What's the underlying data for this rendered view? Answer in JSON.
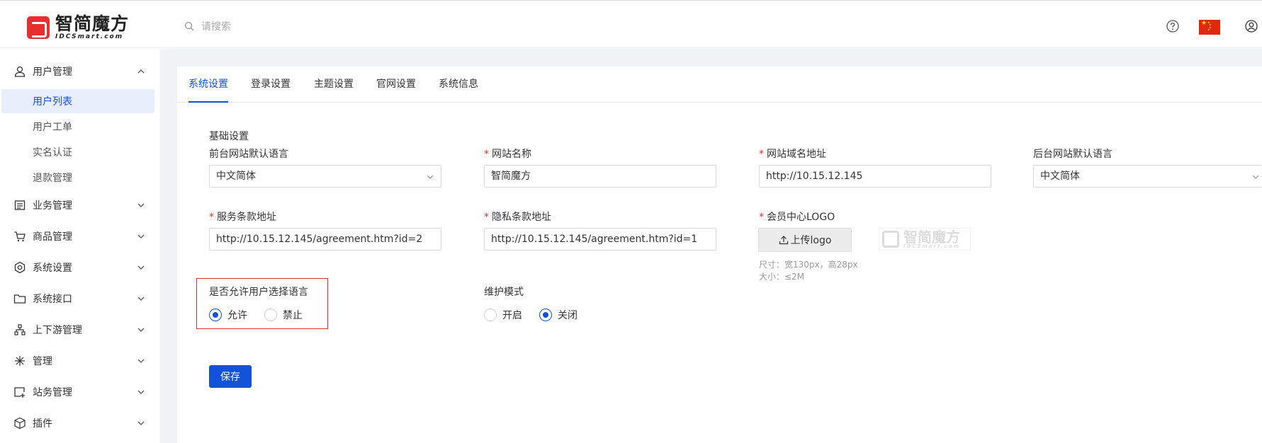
{
  "header": {
    "logo_cn": "智简魔方",
    "logo_en": "IDCSmart.com",
    "search_placeholder": "请搜索",
    "icons": [
      "help-icon",
      "flag-cn-icon",
      "user-icon"
    ]
  },
  "sidebar": {
    "groups": [
      {
        "label": "用户管理",
        "icon": "user-icon",
        "expanded": true,
        "items": [
          {
            "label": "用户列表",
            "active": true
          },
          {
            "label": "用户工单"
          },
          {
            "label": "实名认证"
          },
          {
            "label": "退款管理"
          }
        ]
      },
      {
        "label": "业务管理",
        "icon": "list-icon"
      },
      {
        "label": "商品管理",
        "icon": "cart-icon"
      },
      {
        "label": "系统设置",
        "icon": "gear-icon"
      },
      {
        "label": "系统接口",
        "icon": "folder-icon"
      },
      {
        "label": "上下游管理",
        "icon": "hierarchy-icon"
      },
      {
        "label": "管理",
        "icon": "sparkle-icon"
      },
      {
        "label": "站务管理",
        "icon": "site-icon"
      },
      {
        "label": "插件",
        "icon": "cube-icon"
      }
    ]
  },
  "tabs": [
    "系统设置",
    "登录设置",
    "主题设置",
    "官网设置",
    "系统信息"
  ],
  "active_tab": "系统设置",
  "form": {
    "section_title": "基础设置",
    "front_lang": {
      "label": "前台网站默认语言",
      "value": "中文简体"
    },
    "site_name": {
      "label": "网站名称",
      "value": "智简魔方",
      "required": true
    },
    "site_domain": {
      "label": "网站域名地址",
      "value": "http://10.15.12.145",
      "required": true
    },
    "admin_lang": {
      "label": "后台网站默认语言",
      "value": "中文简体"
    },
    "terms_url": {
      "label": "服务条款地址",
      "value": "http://10.15.12.145/agreement.htm?id=2",
      "required": true
    },
    "privacy_url": {
      "label": "隐私条款地址",
      "value": "http://10.15.12.145/agreement.htm?id=1",
      "required": true
    },
    "member_logo": {
      "label": "会员中心LOGO",
      "required": true,
      "upload_label": "上传logo",
      "hint_size": "尺寸：宽130px，高28px",
      "hint_filesize": "大小：≤2M"
    },
    "allow_lang": {
      "label": "是否允许用户选择语言",
      "options": [
        "允许",
        "禁止"
      ],
      "selected": "允许"
    },
    "maintenance": {
      "label": "维护模式",
      "options": [
        "开启",
        "关闭"
      ],
      "selected": "关闭"
    },
    "save_label": "保存"
  },
  "colors": {
    "primary": "#1252d6",
    "required": "#e5302f",
    "highlight_border": "#e5302f"
  }
}
